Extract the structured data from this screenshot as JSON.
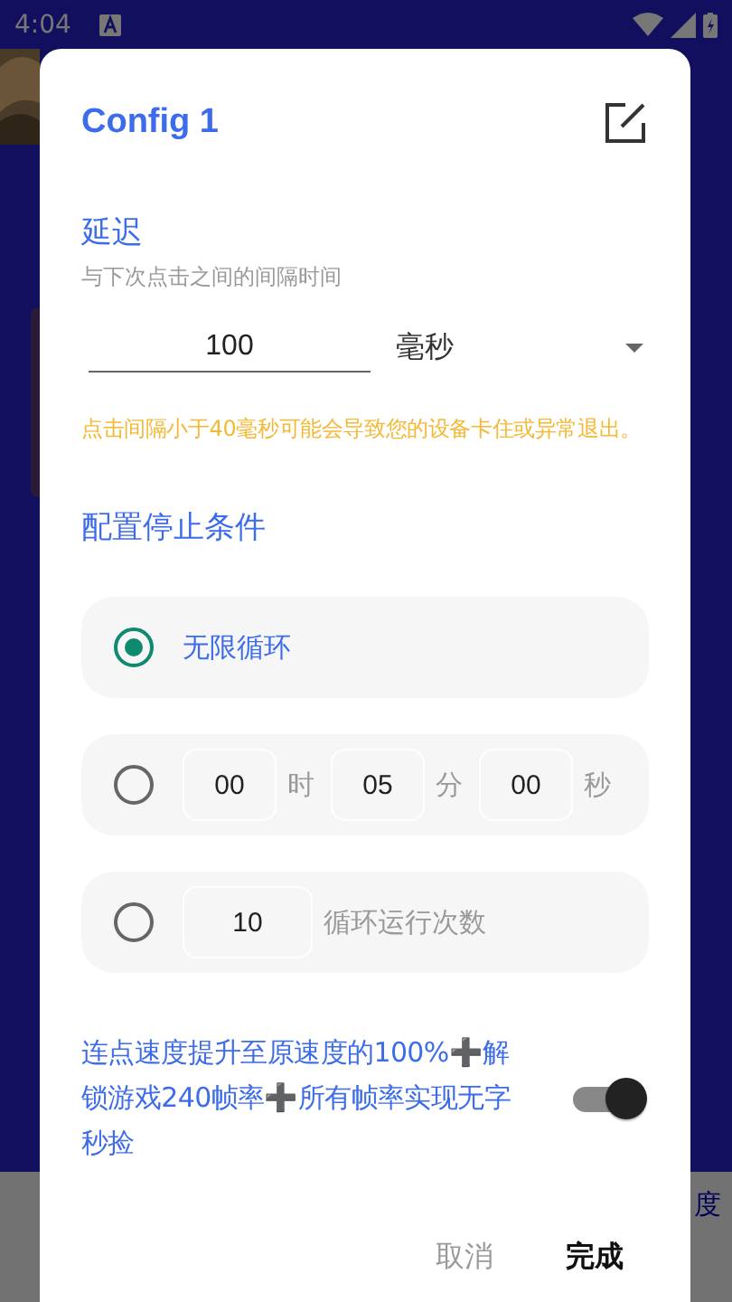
{
  "status_bar": {
    "time": "4:04"
  },
  "background": {
    "partial_text": "度"
  },
  "dialog": {
    "title": "Config 1",
    "delay": {
      "heading": "延迟",
      "description": "与下次点击之间的间隔时间",
      "value": "100",
      "unit": "毫秒",
      "warning": "点击间隔小于40毫秒可能会导致您的设备卡住或异常退出。"
    },
    "stop_condition": {
      "heading": "配置停止条件",
      "options": [
        {
          "kind": "infinite",
          "selected": true,
          "label": "无限循环"
        },
        {
          "kind": "timer",
          "selected": false,
          "fields": [
            {
              "value": "00",
              "unit": "时"
            },
            {
              "value": "05",
              "unit": "分"
            },
            {
              "value": "00",
              "unit": "秒"
            }
          ]
        },
        {
          "kind": "count",
          "selected": false,
          "value": "10",
          "label": "循环运行次数"
        }
      ]
    },
    "boost": {
      "text": "连点速度提升至原速度的100%➕解锁游戏240帧率➕所有帧率实现无字秒捡",
      "on": true
    },
    "buttons": [
      {
        "label": "取消",
        "primary": false
      },
      {
        "label": "完成",
        "primary": true
      }
    ]
  }
}
